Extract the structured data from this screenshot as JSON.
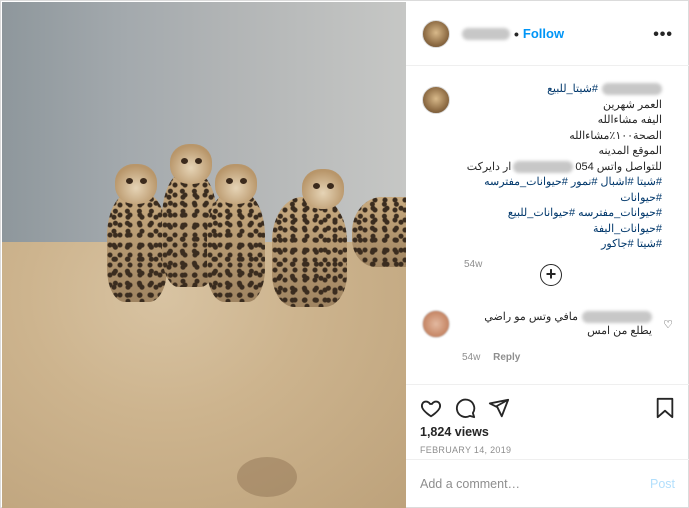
{
  "post": {
    "follow_label": "Follow",
    "more_icon": "more-options-icon",
    "dot": "•"
  },
  "caption": {
    "lines": [
      "#شيتا_للبيع",
      "العمر شهرين",
      "اليفه مشاءالله",
      "الصحة١٠٠٪مشاءالله",
      "الموقع المدينه",
      "للتواصل واتس 054",
      "ار دايركت",
      "#شيتا #اشبال #نمور #حيوانات_مفترسه #حيوانات",
      "#حيوانات_مفترسه #حيوانات_للبيع #حيوانات_اليفة",
      "#شيتا #جاكور"
    ],
    "time": "54w"
  },
  "comment": {
    "text": "مافي وتس مو راضي يطلع من امس",
    "time": "54w",
    "reply_label": "Reply"
  },
  "actions": {
    "views": "1,824 views",
    "date": "FEBRUARY 14, 2019"
  },
  "add_comment": {
    "placeholder": "Add a comment…",
    "post_label": "Post"
  }
}
